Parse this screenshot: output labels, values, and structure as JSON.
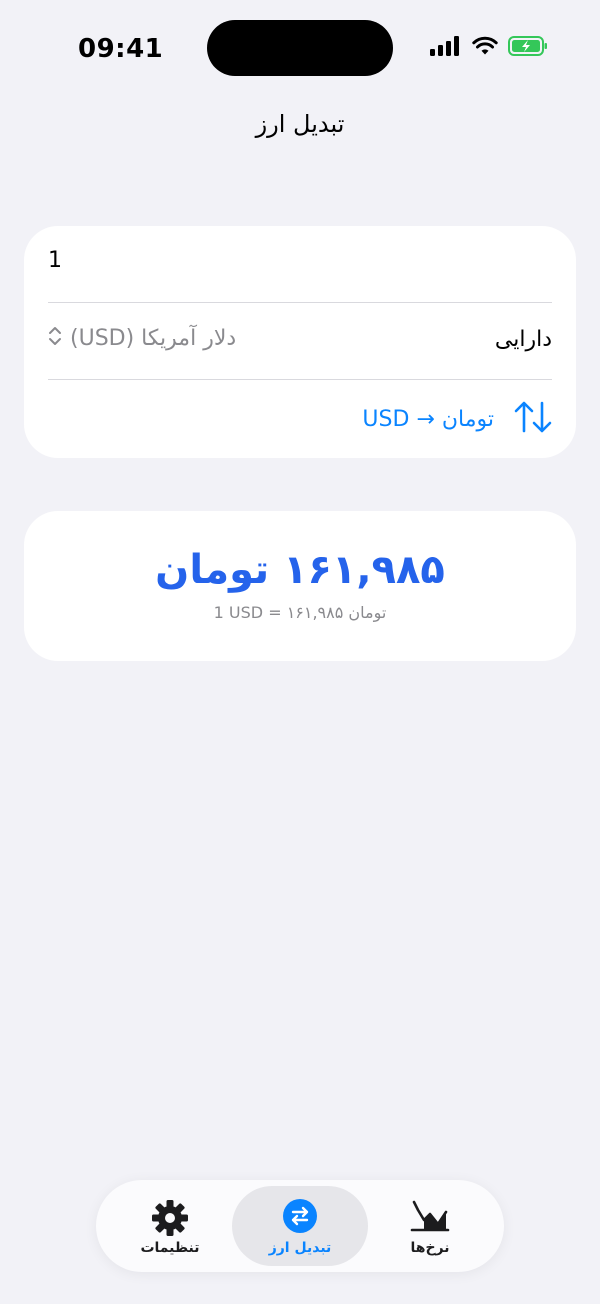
{
  "status_bar": {
    "time": "09:41"
  },
  "header": {
    "title": "تبدیل ارز"
  },
  "converter": {
    "amount_value": "1",
    "amount_placeholder": "",
    "asset_label": "دارایی",
    "asset_selected": "دلار آمریکا (USD)",
    "swap_label": "USD → تومان"
  },
  "result": {
    "value": "۱۶۱,۹۸۵ تومان",
    "rate": "1 USD = ۱۶۱,۹۸۵ تومان"
  },
  "tab_bar": {
    "tabs": [
      {
        "label": "نرخ‌ها",
        "icon": "chart-icon"
      },
      {
        "label": "تبدیل ارز",
        "icon": "convert-icon"
      },
      {
        "label": "تنظیمات",
        "icon": "gear-icon"
      }
    ],
    "active_index": 1
  },
  "colors": {
    "accent": "#0a84ff",
    "result": "#2563eb",
    "background": "#f2f2f7",
    "battery": "#34c759"
  }
}
